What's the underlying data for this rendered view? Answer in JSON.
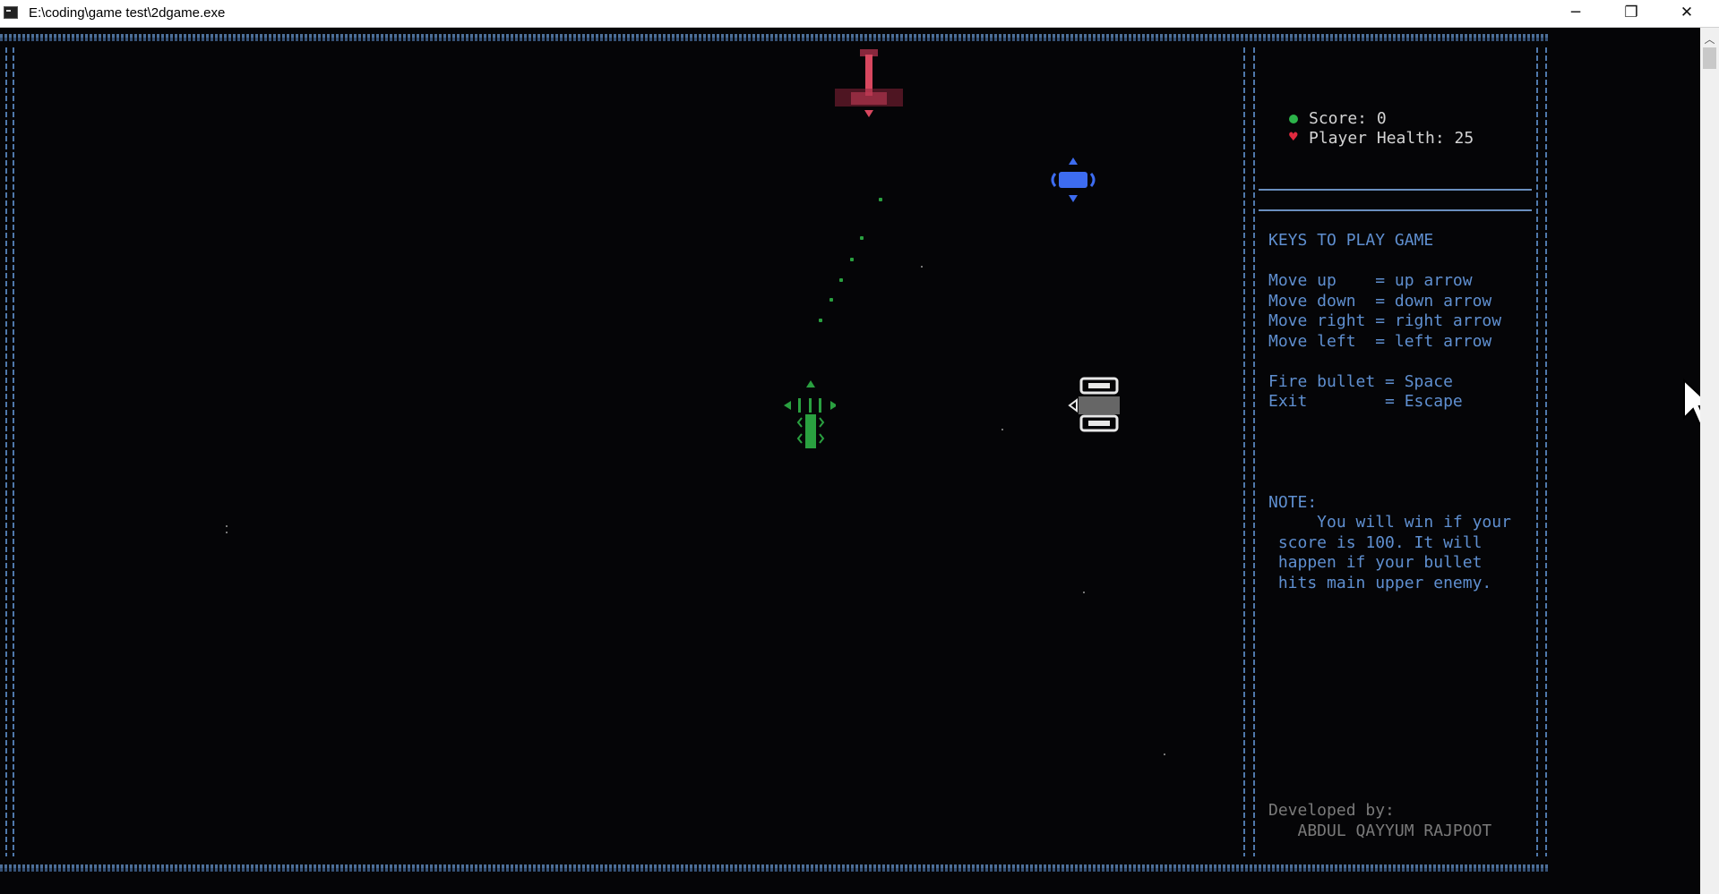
{
  "window": {
    "title": "E:\\coding\\game test\\2dgame.exe",
    "minimize_glyph": "─",
    "restore_glyph": "❐",
    "close_glyph": "✕"
  },
  "status": {
    "score_label": "Score: 0",
    "health_label": "Player Health: 25"
  },
  "keys": {
    "heading": "KEYS TO PLAY GAME",
    "lines": [
      "Move up    = up arrow",
      "Move down  = down arrow",
      "Move right = right arrow",
      "Move left  = left arrow"
    ],
    "fire": "Fire bullet = Space",
    "exit": "Exit        = Escape"
  },
  "note": {
    "heading": "NOTE:",
    "lines": [
      "     You will win if your",
      " score is 100. It will",
      " happen if your bullet",
      " hits main upper enemy."
    ]
  },
  "credits": {
    "label": "Developed by:",
    "name": "   ABDUL QAYYUM RAJPOOT"
  },
  "colors": {
    "border": "#5a82b3",
    "sidebar_text": "#5f8fd0",
    "player": "#2aa040",
    "boss": "#d8475f",
    "enemy_blue": "#3d6cf0",
    "enemy_white": "#e8e8e8"
  },
  "icons": [
    "app-console-icon",
    "green-dot-icon",
    "heart-icon",
    "cursor-arrow-icon"
  ]
}
